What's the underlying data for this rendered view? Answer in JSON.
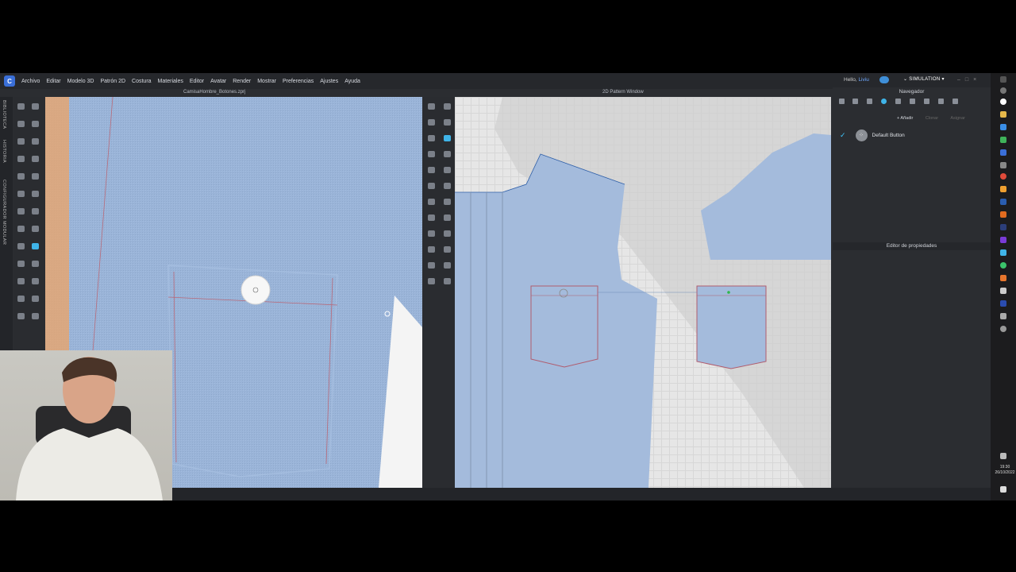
{
  "menu": [
    "Archivo",
    "Editar",
    "Modelo 3D",
    "Patrón 2D",
    "Costura",
    "Materiales",
    "Editor",
    "Avatar",
    "Render",
    "Mostrar",
    "Preferencias",
    "Ajustes",
    "Ayuda"
  ],
  "user": {
    "greeting": "Hello,",
    "name": "Liviu"
  },
  "mode_label": "SIMULATION",
  "side_tabs": [
    "BIBLIOTECA",
    "HISTORIA",
    "CONFIGURADOR MODULAR"
  ],
  "viewport3d": {
    "title": "CamisaHombre_Botones.zprj"
  },
  "viewport2d": {
    "title": "2D Pattern Window"
  },
  "navigator": {
    "title": "Navegador",
    "add_label": "+ Añadir",
    "clone_label": "Clonar",
    "assign_label": "Asignar",
    "items": [
      {
        "label": "Default Button",
        "checked": true
      }
    ]
  },
  "property_editor": {
    "title": "Editor de propiedades"
  },
  "clock": {
    "time": "19:30",
    "date": "26/10/2022"
  },
  "colors": {
    "fabric": "#9ab4d8",
    "accent": "#3fb4e8",
    "ui_bg": "#2b2d31"
  }
}
